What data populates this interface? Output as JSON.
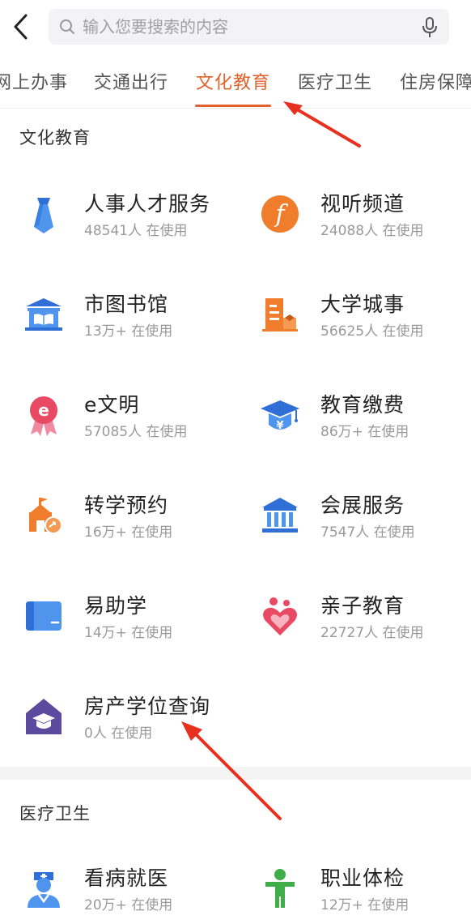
{
  "search": {
    "placeholder": "输入您要搜索的内容"
  },
  "tabs": [
    {
      "label": "网上办事"
    },
    {
      "label": "交通出行"
    },
    {
      "label": "文化教育"
    },
    {
      "label": "医疗卫生"
    },
    {
      "label": "住房保障"
    }
  ],
  "active_tab": "文化教育",
  "sections": [
    {
      "title": "文化教育",
      "items": [
        {
          "name": "人事人才服务",
          "usage": "48541人 在使用",
          "icon": "tie-icon"
        },
        {
          "name": "视听频道",
          "usage": "24088人 在使用",
          "icon": "media-channel-icon"
        },
        {
          "name": "市图书馆",
          "usage": "13万+ 在使用",
          "icon": "library-icon"
        },
        {
          "name": "大学城事",
          "usage": "56625人 在使用",
          "icon": "university-building-icon"
        },
        {
          "name": "e文明",
          "usage": "57085人 在使用",
          "icon": "e-badge-icon"
        },
        {
          "name": "教育缴费",
          "usage": "86万+ 在使用",
          "icon": "graduation-cap-yuan-icon"
        },
        {
          "name": "转学预约",
          "usage": "16万+ 在使用",
          "icon": "school-transfer-icon"
        },
        {
          "name": "会展服务",
          "usage": "7547人 在使用",
          "icon": "exhibition-hall-icon"
        },
        {
          "name": "易助学",
          "usage": "14万+ 在使用",
          "icon": "book-icon"
        },
        {
          "name": "亲子教育",
          "usage": "22727人 在使用",
          "icon": "parent-child-heart-icon"
        },
        {
          "name": "房产学位查询",
          "usage": "0人 在使用",
          "icon": "house-cap-icon"
        }
      ]
    },
    {
      "title": "医疗卫生",
      "items": [
        {
          "name": "看病就医",
          "usage": "20万+ 在使用",
          "icon": "nurse-icon"
        },
        {
          "name": "职业体检",
          "usage": "12万+ 在使用",
          "icon": "person-checkup-icon"
        }
      ]
    }
  ],
  "colors": {
    "accent": "#e0632e",
    "annotation_arrow": "#e8301f",
    "blue": "#3f8ce8",
    "orange": "#ef7d2b",
    "pink": "#e84a63",
    "purple": "#5b4a9e",
    "green": "#3fae49"
  }
}
